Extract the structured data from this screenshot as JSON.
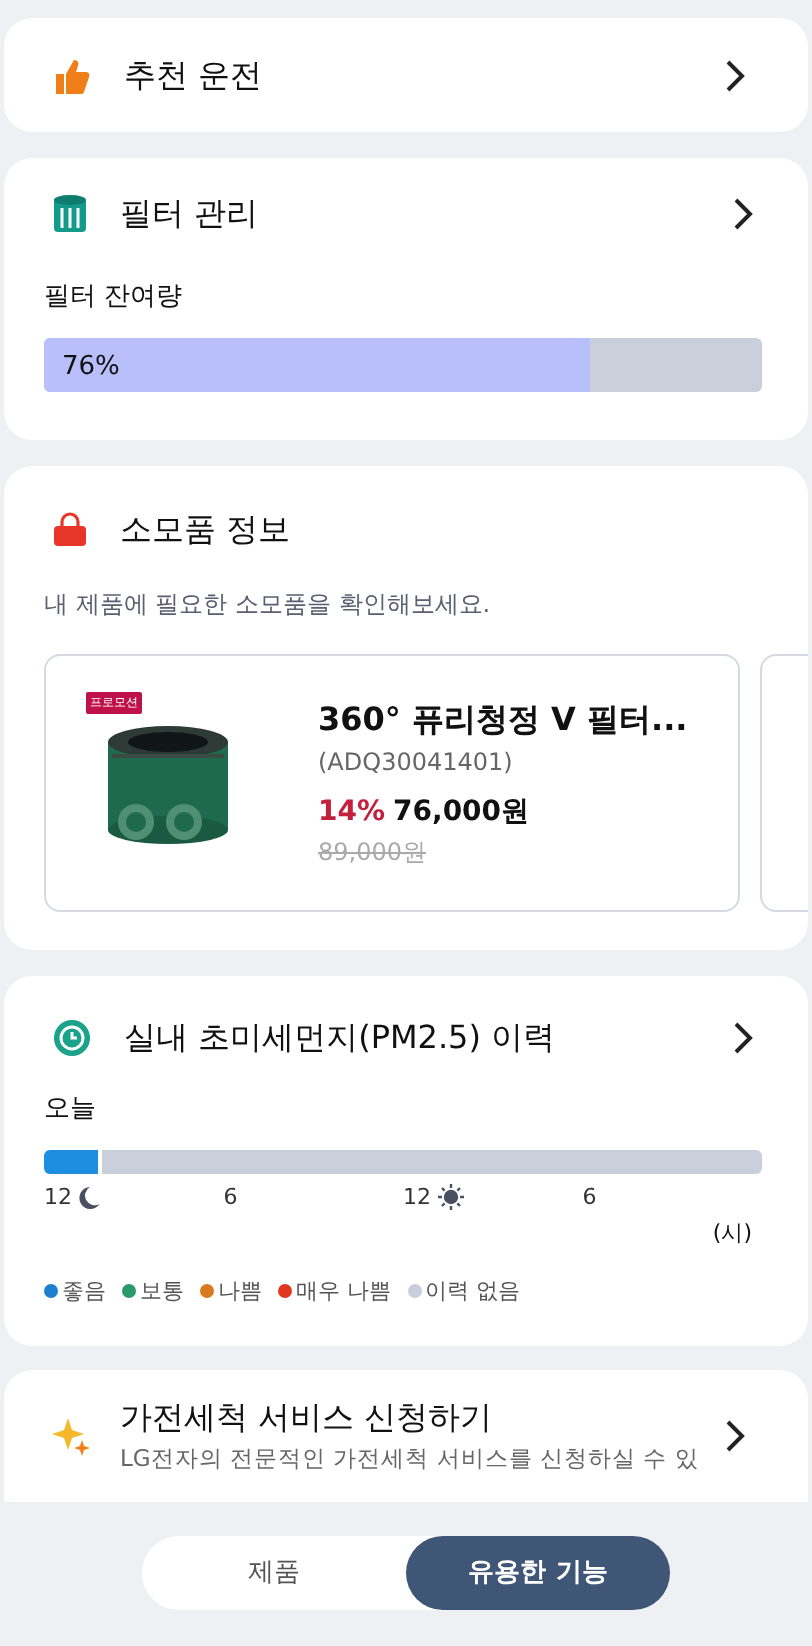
{
  "recommended": {
    "title": "추천 운전"
  },
  "filter": {
    "title": "필터 관리",
    "label": "필터 잔여량",
    "reading": "76%",
    "level": 0.76
  },
  "consumables": {
    "title": "소모품 정보",
    "subtitle": "내 제품에 필요한 소모품을 확인해보세요.",
    "products": [
      {
        "badge": "프로모션",
        "kind": "picture",
        "name": "360° 퓨리청정 V 필터...",
        "code": "(ADQ30041401)",
        "discount": "14%",
        "price": "76,000원",
        "original_price": "89,000원"
      }
    ]
  },
  "pm_history": {
    "title": "실내 초미세먼지(PM2.5) 이력",
    "day": "오늘",
    "segments": [
      {
        "color": "#1d8fe0",
        "level": 0.08
      }
    ],
    "ticks": [
      {
        "label": "12",
        "kind": "moon"
      },
      {
        "label": "6",
        "kind": "none"
      },
      {
        "label": "12",
        "kind": "sun"
      },
      {
        "label": "6",
        "kind": "none"
      }
    ],
    "unit": "(시)",
    "legend": [
      {
        "label": "좋음",
        "color": "#1d7fd0"
      },
      {
        "label": "보통",
        "color": "#2a9a6a"
      },
      {
        "label": "나쁨",
        "color": "#d87a1e"
      },
      {
        "label": "매우 나쁨",
        "color": "#e2371f"
      },
      {
        "label": "이력 없음",
        "color": "#c8cedb"
      }
    ]
  },
  "cleaning": {
    "title": "가전세척 서비스 신청하기",
    "description": "LG전자의 전문적인 가전세척 서비스를 신청하실 수 있"
  },
  "bottom_tabs": [
    {
      "label": "제품",
      "selected": false
    },
    {
      "label": "유용한 기능",
      "selected": true
    }
  ]
}
